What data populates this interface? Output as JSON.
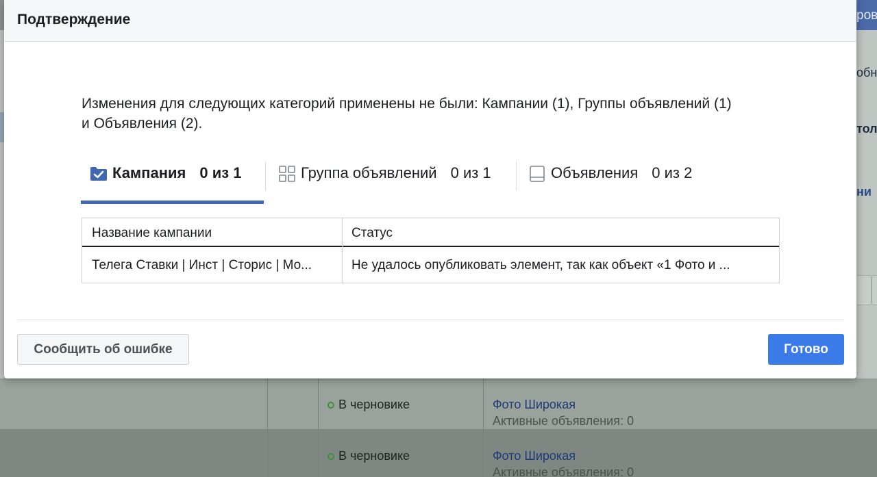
{
  "background": {
    "topbar_text": "ров",
    "right_panel": {
      "line1": "обн",
      "line2": "тол",
      "line3": "ни"
    },
    "rows": [
      {
        "status": "В черновике",
        "campaign": "Фото Широкая",
        "subtitle": "Активные объявления: 0"
      },
      {
        "status": "В черновике",
        "campaign": "Фото Широкая",
        "subtitle": "Активные объявления: 0"
      }
    ]
  },
  "modal": {
    "title": "Подтверждение",
    "message": "Изменения для следующих категорий применены не были: Кампании (1), Группы объявлений (1) и Объявления (2).",
    "tabs": [
      {
        "label": "Кампания",
        "count": "0 из 1",
        "icon": "folder-check-icon",
        "active": true
      },
      {
        "label": "Группа объявлений",
        "count": "0 из 1",
        "icon": "grid-icon",
        "active": false
      },
      {
        "label": "Объявления",
        "count": "0 из 2",
        "icon": "ad-preview-icon",
        "active": false
      }
    ],
    "table": {
      "headers": [
        "Название кампании",
        "Статус"
      ],
      "rows": [
        [
          "Телега Ставки | Инст | Сторис | Мо...",
          "Не удалось опубликовать элемент, так как объект «1 Фото и ..."
        ]
      ]
    },
    "buttons": {
      "report": "Сообщить об ошибке",
      "done": "Готово"
    }
  },
  "colors": {
    "accent": "#4267b2",
    "primary_button": "#3b7be8",
    "draft_status": "#3f8f3a"
  }
}
